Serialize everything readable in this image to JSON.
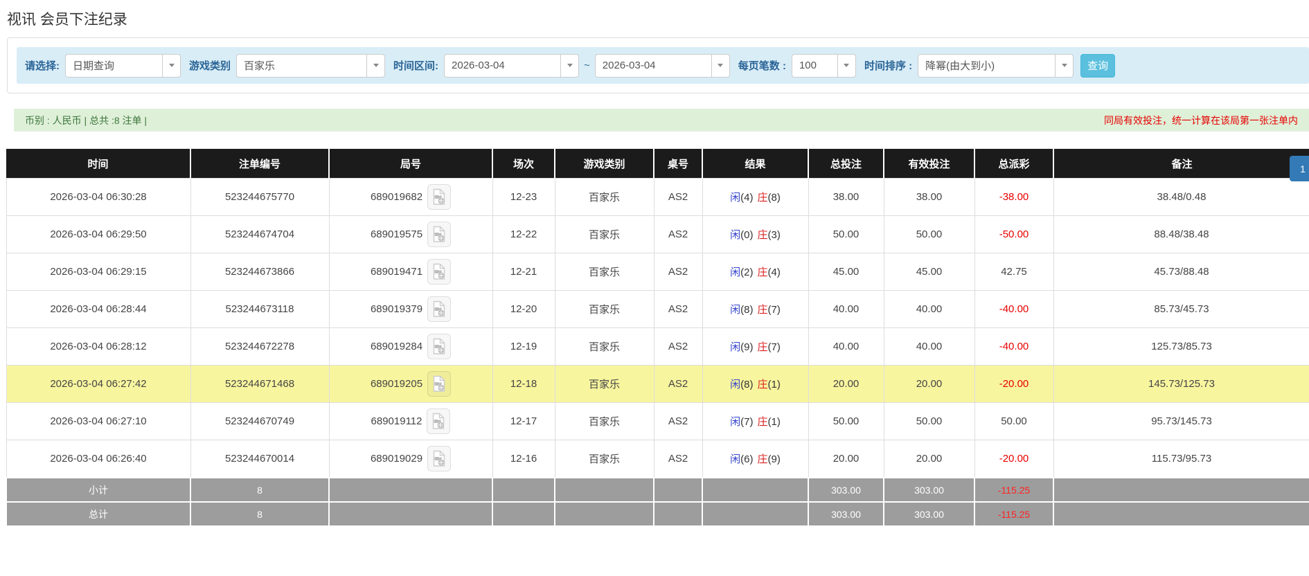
{
  "page": {
    "title": "视讯 会员下注纪录"
  },
  "filters": {
    "select_label": "请选择:",
    "select_value": "日期查询",
    "game_label": "游戏类别",
    "game_value": "百家乐",
    "range_label": "时间区间:",
    "date_from": "2026-03-04",
    "range_separator": "~",
    "date_to": "2026-03-04",
    "page_size_label": "每页笔数 :",
    "page_size_value": "100",
    "sort_label": "时间排序 :",
    "sort_value": "降幂(由大到小)",
    "search_button": "查询"
  },
  "summary_bar": {
    "left_text": "币别 : 人民币 | 总共 :8 注单 |",
    "right_note": "同局有效投注，统一计算在该局第一张注单内"
  },
  "pagination": {
    "current_page": "1"
  },
  "table": {
    "headers": [
      "时间",
      "注单编号",
      "局号",
      "场次",
      "游戏类别",
      "桌号",
      "结果",
      "总投注",
      "有效投注",
      "总派彩",
      "备注"
    ],
    "rows": [
      {
        "time": "2026-03-04 06:30:28",
        "bet_id": "523244675770",
        "round_id": "689019682",
        "session": "12-23",
        "game": "百家乐",
        "table_no": "AS2",
        "result": {
          "player": "闲",
          "player_points": "(4)",
          "banker": "庄",
          "banker_points": "(8)"
        },
        "total_bet": "38.00",
        "valid_bet": "38.00",
        "payout": "-38.00",
        "note": "38.48/0.48",
        "highlighted": false
      },
      {
        "time": "2026-03-04 06:29:50",
        "bet_id": "523244674704",
        "round_id": "689019575",
        "session": "12-22",
        "game": "百家乐",
        "table_no": "AS2",
        "result": {
          "player": "闲",
          "player_points": "(0)",
          "banker": "庄",
          "banker_points": "(3)"
        },
        "total_bet": "50.00",
        "valid_bet": "50.00",
        "payout": "-50.00",
        "note": "88.48/38.48",
        "highlighted": false
      },
      {
        "time": "2026-03-04 06:29:15",
        "bet_id": "523244673866",
        "round_id": "689019471",
        "session": "12-21",
        "game": "百家乐",
        "table_no": "AS2",
        "result": {
          "player": "闲",
          "player_points": "(2)",
          "banker": "庄",
          "banker_points": "(4)"
        },
        "total_bet": "45.00",
        "valid_bet": "45.00",
        "payout": "42.75",
        "note": "45.73/88.48",
        "highlighted": false
      },
      {
        "time": "2026-03-04 06:28:44",
        "bet_id": "523244673118",
        "round_id": "689019379",
        "session": "12-20",
        "game": "百家乐",
        "table_no": "AS2",
        "result": {
          "player": "闲",
          "player_points": "(8)",
          "banker": "庄",
          "banker_points": "(7)"
        },
        "total_bet": "40.00",
        "valid_bet": "40.00",
        "payout": "-40.00",
        "note": "85.73/45.73",
        "highlighted": false
      },
      {
        "time": "2026-03-04 06:28:12",
        "bet_id": "523244672278",
        "round_id": "689019284",
        "session": "12-19",
        "game": "百家乐",
        "table_no": "AS2",
        "result": {
          "player": "闲",
          "player_points": "(9)",
          "banker": "庄",
          "banker_points": "(7)"
        },
        "total_bet": "40.00",
        "valid_bet": "40.00",
        "payout": "-40.00",
        "note": "125.73/85.73",
        "highlighted": false
      },
      {
        "time": "2026-03-04 06:27:42",
        "bet_id": "523244671468",
        "round_id": "689019205",
        "session": "12-18",
        "game": "百家乐",
        "table_no": "AS2",
        "result": {
          "player": "闲",
          "player_points": "(8)",
          "banker": "庄",
          "banker_points": "(1)"
        },
        "total_bet": "20.00",
        "valid_bet": "20.00",
        "payout": "-20.00",
        "note": "145.73/125.73",
        "highlighted": true
      },
      {
        "time": "2026-03-04 06:27:10",
        "bet_id": "523244670749",
        "round_id": "689019112",
        "session": "12-17",
        "game": "百家乐",
        "table_no": "AS2",
        "result": {
          "player": "闲",
          "player_points": "(7)",
          "banker": "庄",
          "banker_points": "(1)"
        },
        "total_bet": "50.00",
        "valid_bet": "50.00",
        "payout": "50.00",
        "note": "95.73/145.73",
        "highlighted": false
      },
      {
        "time": "2026-03-04 06:26:40",
        "bet_id": "523244670014",
        "round_id": "689019029",
        "session": "12-16",
        "game": "百家乐",
        "table_no": "AS2",
        "result": {
          "player": "闲",
          "player_points": "(6)",
          "banker": "庄",
          "banker_points": "(9)"
        },
        "total_bet": "20.00",
        "valid_bet": "20.00",
        "payout": "-20.00",
        "note": "115.73/95.73",
        "highlighted": false
      }
    ],
    "subtotal": {
      "label": "小计",
      "count": "8",
      "total_bet": "303.00",
      "valid_bet": "303.00",
      "payout": "-115.25"
    },
    "total": {
      "label": "总计",
      "count": "8",
      "total_bet": "303.00",
      "valid_bet": "303.00",
      "payout": "-115.25"
    }
  },
  "colors": {
    "header_bg": "#1b1b1b",
    "highlight_yellow": "#f8f59f",
    "summary_gray": "#9d9d9d",
    "filter_bar_bg": "#d9edf7",
    "filter_label_blue": "#2a6496",
    "summary_bar_bg": "#dff0d8",
    "summary_text_green": "#3c763d",
    "note_red": "#e60000",
    "link_blue": "#3a7bd5",
    "player_blue": "#3344cc",
    "banker_red": "#dd2222",
    "negative_red": "#e60000",
    "search_button_bg": "#5bc0de",
    "pagination_bg": "#337ab7"
  }
}
